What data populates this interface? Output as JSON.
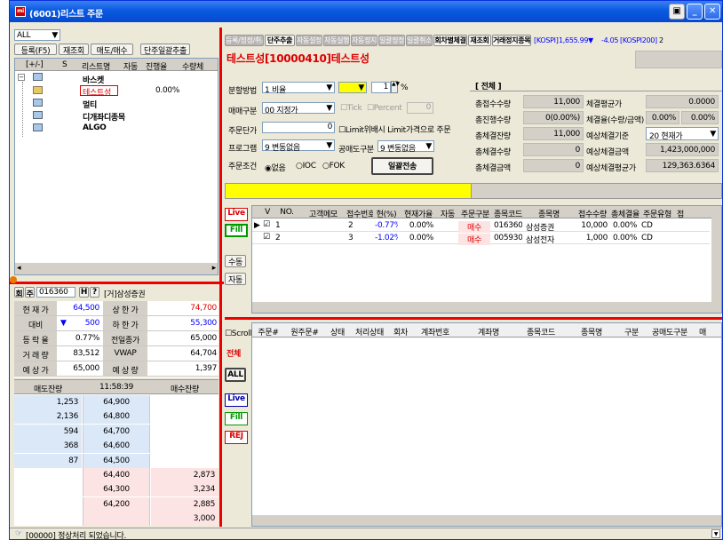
{
  "window": {
    "title": "(6001)리스트 주문",
    "icon": "app-icon"
  },
  "left": {
    "combo_value": "ALL",
    "btns": [
      "등록(F5)",
      "재조회",
      "매도/매수",
      "단주일괄추출"
    ],
    "tree_headers": [
      "[+/-]",
      "S",
      "리스트명",
      "자동",
      "진행율",
      "수량체"
    ],
    "tree_rows": [
      {
        "name": "바스켓",
        "pct": ""
      },
      {
        "name": "테스트성",
        "pct": "0.00%"
      },
      {
        "name": "멀티",
        "pct": ""
      },
      {
        "name": "디개좌디종목",
        "pct": ""
      },
      {
        "name": "ALGO",
        "pct": ""
      }
    ]
  },
  "quote": {
    "tab1": "회",
    "tab2": "주",
    "code": "016360",
    "h": "H",
    "q": "?",
    "name": "[거]삼성증권",
    "rows": [
      {
        "l1": "현 재 가",
        "v1": "64,500",
        "l2": "상 한 가",
        "v2": "74,700"
      },
      {
        "l1": "대비",
        "arrow": "▼",
        "v1": "500",
        "l2": "하 한 가",
        "v2": "55,300"
      },
      {
        "l1": "등 락 율",
        "v1": "0.77%",
        "l2": "전일종가",
        "v2": "65,000"
      },
      {
        "l1": "거 래 량",
        "v1": "83,512",
        "l2": "VWAP",
        "v2": "64,704"
      },
      {
        "l1": "예 상 가",
        "v1": "65,000",
        "l2": "예 상 량",
        "v2": "1,397"
      }
    ],
    "ob_head": [
      "매도잔량",
      "11:58:39",
      "매수잔량"
    ],
    "ob": [
      {
        "s": "1,253",
        "p": "64,900",
        "b": ""
      },
      {
        "s": "2,136",
        "p": "64,800",
        "b": ""
      },
      {
        "s": "594",
        "p": "64,700",
        "b": ""
      },
      {
        "s": "368",
        "p": "64,600",
        "b": ""
      },
      {
        "s": "87",
        "p": "64,500",
        "b": ""
      },
      {
        "s": "",
        "p": "64,400",
        "b": "2,873"
      },
      {
        "s": "",
        "p": "64,300",
        "b": "3,234"
      },
      {
        "s": "",
        "p": "64,200",
        "b": "2,885"
      },
      {
        "s": "",
        "p": "",
        "b": "3,000"
      }
    ]
  },
  "toolbar": {
    "btns": [
      "등록/정정/취소",
      "단주추출",
      "자동설정",
      "자동실행",
      "자동정지",
      "일괄정정",
      "일괄취소",
      "회차별체결",
      "재조회",
      "거래정지종목"
    ],
    "kospi_label": "[KOSPI]",
    "kospi_val": "1,655.99",
    "kospi_arrow": "▼",
    "kospi_chg": "-4.05",
    "kospi200_label": "[KOSPI200]",
    "kospi200_val": "2"
  },
  "list_title": "테스트성[10000410]테스트성",
  "form": {
    "split_label": "분할방법",
    "split_val": "1 비율",
    "pct_val": "1",
    "pct_unit": "%",
    "type_label": "매매구분",
    "type_val": "00 지정가",
    "tick": "Tick",
    "percent": "Percent",
    "pct2": "0",
    "price_label": "주문단가",
    "price_val": "0",
    "limit_chk": "Limit위배시 Limit가격으로 주문",
    "prog_label": "프로그램",
    "prog_val": "9 변동없음",
    "short_label": "공매도구분",
    "short_val": "9 변동없음",
    "cond_label": "주문조건",
    "cond_opts": [
      "없음",
      "IOC",
      "FOK"
    ],
    "send_btn": "일괄전송"
  },
  "summary": {
    "title": "[ 전체 ]",
    "rows": [
      {
        "l": "총접수수량",
        "v": "11,000",
        "l2": "체결평균가",
        "v2": "0.0000"
      },
      {
        "l": "총진행수량",
        "v": "0(0.00%)",
        "l2": "체결율(수량/금액)",
        "v2a": "0.00%",
        "v2": "0.00%"
      },
      {
        "l": "총체결잔량",
        "v": "11,000",
        "l2": "예상체결기준",
        "v2": "20 현재가"
      },
      {
        "l": "총체결수량",
        "v": "0",
        "l2": "예상체결금액",
        "v2": "1,423,000,000"
      },
      {
        "l": "총체결금액",
        "v": "0",
        "l2": "예상체결평균가",
        "v2": "129,363.6364"
      }
    ]
  },
  "side_btns": {
    "live": "Live",
    "fill": "Fill",
    "manual": "수동",
    "auto": "자동",
    "scroll": "Scroll",
    "all_lbl": "전체",
    "all": "ALL",
    "live2": "Live",
    "fill2": "Fill",
    "rej": "REJ"
  },
  "grid1": {
    "headers": [
      "V",
      "NO.",
      "고객메모",
      "접수번호",
      "현(%)",
      "현재가율",
      "자동",
      "주문구분",
      "종목코드",
      "종목명",
      "접수수량",
      "총체결율",
      "주문유형",
      "접"
    ],
    "rows": [
      {
        "no": "1",
        "memo": "",
        "rcv": "2",
        "cur": "-0.77%",
        "rate": "0.00%",
        "auto": "",
        "side": "매수",
        "code": "016360",
        "name": "삼성증권",
        "qty": "10,000",
        "fill": "0.00%",
        "otype": "CD"
      },
      {
        "no": "2",
        "memo": "",
        "rcv": "3",
        "cur": "-1.02%",
        "rate": "0.00%",
        "auto": "",
        "side": "매수",
        "code": "005930",
        "name": "삼성전자",
        "qty": "1,000",
        "fill": "0.00%",
        "otype": "CD"
      }
    ]
  },
  "grid2": {
    "headers": [
      "주문#",
      "원주문#",
      "상태",
      "처리상태",
      "회차",
      "계좌번호",
      "계좌명",
      "종목코드",
      "종목명",
      "구분",
      "공매도구분",
      "매"
    ]
  },
  "status": {
    "text": "[00000] 정상처리 되었습니다."
  }
}
